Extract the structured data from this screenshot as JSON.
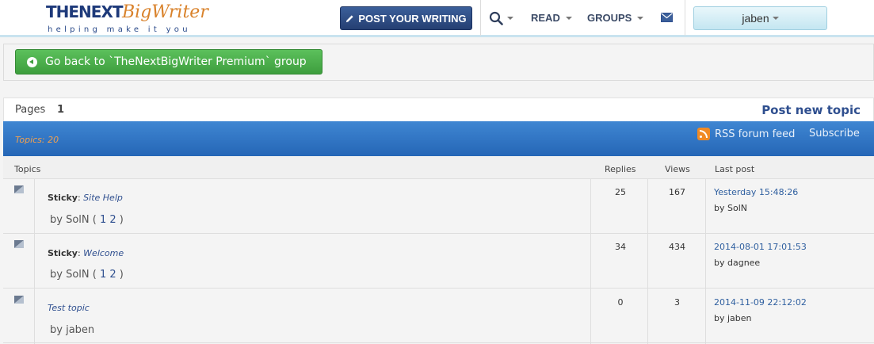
{
  "header": {
    "logo_main": "THENEXT",
    "logo_script": "BigWriter",
    "logo_tagline": "helping make it you",
    "post_writing_label": "POST YOUR WRITING",
    "nav_read": "READ",
    "nav_groups": "GROUPS",
    "user_name": "jaben"
  },
  "back_button_label": "Go back to `TheNextBigWriter Premium` group",
  "pages": {
    "label": "Pages",
    "current": "1",
    "post_new_topic": "Post new topic"
  },
  "forum_bar": {
    "topics_count": "Topics: 20",
    "rss_label": "RSS forum feed",
    "subscribe_label": "Subscribe"
  },
  "table": {
    "columns": [
      "Topics",
      "Replies",
      "Views",
      "Last post"
    ],
    "rows": [
      {
        "prefix": "Sticky",
        "title": "Site Help",
        "author": "by SolN",
        "page_links": [
          "1",
          "2"
        ],
        "replies": "25",
        "views": "167",
        "last_post_date": "Yesterday 15:48:26",
        "last_post_by": "by SolN"
      },
      {
        "prefix": "Sticky",
        "title": "Welcome",
        "author": "by SolN",
        "page_links": [
          "1",
          "2"
        ],
        "replies": "34",
        "views": "434",
        "last_post_date": "2014-08-01 17:01:53",
        "last_post_by": "by dagnee"
      },
      {
        "prefix": "",
        "title": "Test topic",
        "author": "by jaben",
        "page_links": [],
        "replies": "0",
        "views": "3",
        "last_post_date": "2014-11-09 22:12:02",
        "last_post_by": "by jaben"
      }
    ]
  },
  "icons": {
    "pencil": "pencil-icon",
    "search": "search-icon",
    "mail": "mail-icon",
    "back": "back-arrow-icon",
    "rss": "rss-icon",
    "topic_flag": "topic-flag-icon"
  },
  "colors": {
    "post_button": "#2e4e86",
    "back_button": "#4cae4c",
    "forum_band": "#2f74c4",
    "link": "#2f4f8f",
    "topics_count": "#f0a050"
  }
}
